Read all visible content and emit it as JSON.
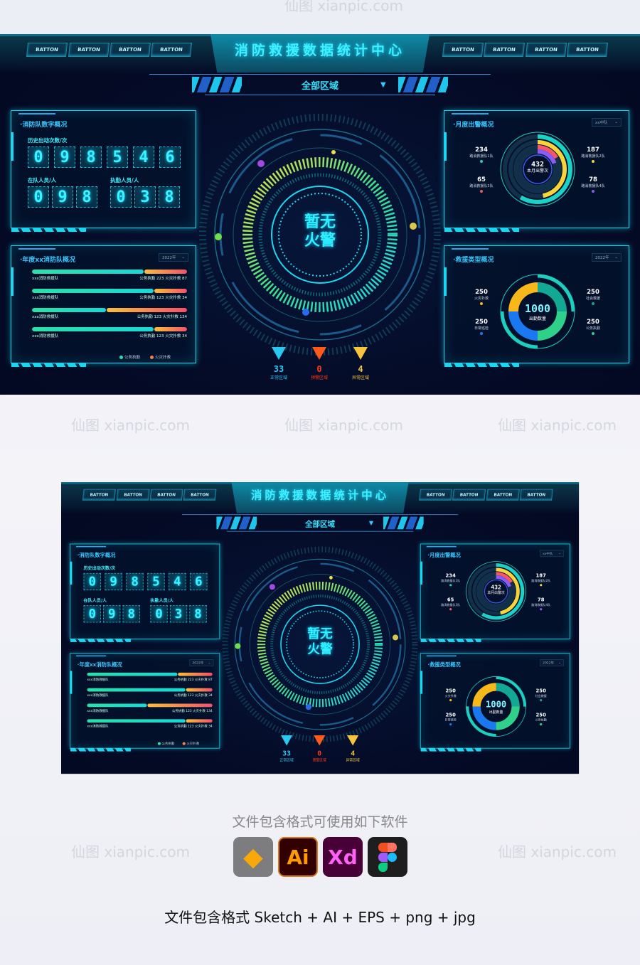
{
  "watermark": "仙图 xianpic.com",
  "header": {
    "title": "消防救援数据统计中心",
    "left_buttons": [
      "BATTON",
      "BATTON",
      "BATTON",
      "BATTON"
    ],
    "right_buttons": [
      "BATTON",
      "BATTON",
      "BATTON",
      "BATTON"
    ],
    "region_select": "全部区域"
  },
  "team_digits": {
    "title": "·消防队数字概况",
    "history_label": "历史出动次数/次",
    "history_digits": [
      "0",
      "9",
      "8",
      "5",
      "4",
      "6"
    ],
    "onduty_team_label": "在队人员/人",
    "onduty_team_digits": [
      "0",
      "9",
      "8"
    ],
    "duty_label": "执勤人员/人",
    "duty_digits": [
      "0",
      "3",
      "8"
    ]
  },
  "annual": {
    "title": "·年度xx消防队概况",
    "year_select": "2022年",
    "duty_label": "公务执勤",
    "fire_label": "火灾扑救",
    "rows": [
      {
        "name": "xxx消防救援队",
        "duty": 223,
        "fire": 87
      },
      {
        "name": "xxx消防救援队",
        "duty": 123,
        "fire": 34
      },
      {
        "name": "xxx消防救援队",
        "duty": 123,
        "fire": 134
      },
      {
        "name": "xxx消防救援队",
        "duty": 123,
        "fire": 34
      }
    ],
    "legend": [
      "公务执勤",
      "火灾扑救"
    ],
    "colors": {
      "duty": "#2be0a8",
      "fire": "#f5804a"
    }
  },
  "center": {
    "line1": "暂无",
    "line2": "火警",
    "indicators": [
      {
        "value": "33",
        "label": "正常区域",
        "color": "#28c8f0"
      },
      {
        "value": "0",
        "label": "预警区域",
        "color": "#ff3a1a"
      },
      {
        "value": "4",
        "label": "异常区域",
        "color": "#f8c43a"
      }
    ]
  },
  "monthly": {
    "title": "·月度出警概况",
    "team_select": "xx中队",
    "total": "432",
    "total_label": "本月出警次",
    "teams": [
      {
        "value": 234,
        "label": "路消救援队1队",
        "color": "#19d2c8"
      },
      {
        "value": 187,
        "label": "路消救援队2队",
        "color": "#f8d43a"
      },
      {
        "value": 65,
        "label": "路消救援队3队",
        "color": "#f5566a"
      },
      {
        "value": 78,
        "label": "路消救援队4队",
        "color": "#8a5cf5"
      }
    ]
  },
  "rescue": {
    "title": "·救援类型概况",
    "year_select": "2022年",
    "total": "1000",
    "total_label": "出勤数量",
    "types": [
      {
        "value": 250,
        "label": "火灾扑救",
        "color": "#f8b81a"
      },
      {
        "value": 250,
        "label": "社会救援",
        "color": "#12a894"
      },
      {
        "value": 250,
        "label": "公务执勤",
        "color": "#2fd18a"
      },
      {
        "value": 250,
        "label": "日常巡检",
        "color": "#1a78f0"
      }
    ]
  },
  "footer": {
    "software_title": "文件包含格式可使用如下软件",
    "apps": [
      "Sketch",
      "Ai",
      "Xd",
      "Figma"
    ],
    "formats": "文件包含格式 Sketch + AI + EPS + png + jpg"
  }
}
